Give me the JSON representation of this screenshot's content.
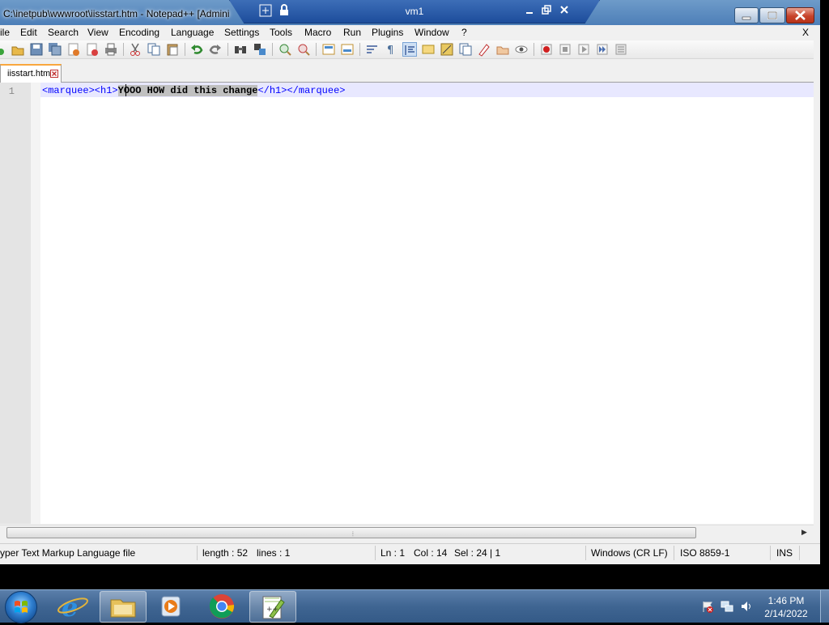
{
  "window": {
    "title": "C:\\inetpub\\wwwroot\\iisstart.htm - Notepad++ [Admini"
  },
  "vm_bar": {
    "title": "vm1"
  },
  "menu": {
    "items": [
      "ile",
      "Edit",
      "Search",
      "View",
      "Encoding",
      "Language",
      "Settings",
      "Tools",
      "Macro",
      "Run",
      "Plugins",
      "Window",
      "?"
    ],
    "close_label": "X"
  },
  "toolbar": {
    "icons": [
      "new-file-icon",
      "open-file-icon",
      "save-icon",
      "save-all-icon",
      "close-icon",
      "close-all-icon",
      "print-icon",
      "cut-icon",
      "copy-icon",
      "paste-icon",
      "undo-icon",
      "redo-icon",
      "find-icon",
      "replace-icon",
      "zoom-in-icon",
      "zoom-out-icon",
      "sync-vertical-icon",
      "sync-horizontal-icon",
      "word-wrap-icon",
      "show-all-chars-icon",
      "indent-guide-icon",
      "user-defined-language-icon",
      "document-map-icon",
      "function-list-icon",
      "folder-as-workspace-icon",
      "monitoring-icon",
      "record-macro-icon",
      "stop-record-icon",
      "playback-macro-icon",
      "run-macro-multiple-icon",
      "save-macro-icon"
    ],
    "active_icon": "indent-guide-icon"
  },
  "tabs": [
    {
      "label": "iisstart.htm"
    }
  ],
  "editor": {
    "line_number": "1",
    "code": {
      "prefix": "<marquee><h1>",
      "selected": "YOOO HOW did this change",
      "suffix": "</h1></marquee>"
    }
  },
  "statusbar": {
    "file_type": "yper Text Markup Language file",
    "length": "length : 52",
    "lines": "lines : 1",
    "ln": "Ln : 1",
    "col": "Col : 14",
    "sel": "Sel : 24 | 1",
    "eol": "Windows (CR LF)",
    "encoding": "ISO 8859-1",
    "mode": "INS"
  },
  "taskbar": {
    "apps": [
      "internet-explorer-icon",
      "windows-explorer-icon",
      "media-player-icon",
      "chrome-icon",
      "notepad-plus-plus-icon"
    ],
    "time": "1:46 PM",
    "date": "2/14/2022"
  },
  "colors": {
    "tag_blue": "#0000ff",
    "tab_accent": "#f9a73e",
    "current_line": "#e8e8ff"
  }
}
